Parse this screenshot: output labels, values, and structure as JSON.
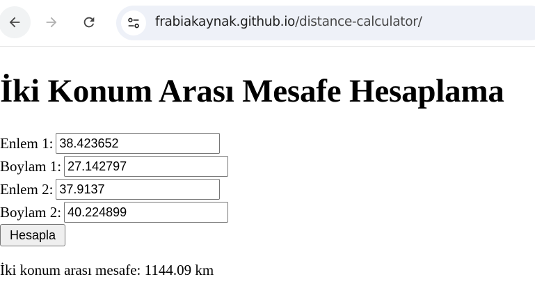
{
  "browser": {
    "url_host": "frabiakaynak.github.io",
    "url_path": "/distance-calculator/"
  },
  "page": {
    "title": "İki Konum Arası Mesafe Hesaplama",
    "fields": [
      {
        "label": "Enlem 1:",
        "value": "38.423652"
      },
      {
        "label": "Boylam 1:",
        "value": "27.142797"
      },
      {
        "label": "Enlem 2:",
        "value": "37.9137"
      },
      {
        "label": "Boylam 2:",
        "value": "40.224899"
      }
    ],
    "button_label": "Hesapla",
    "result_text": "İki konum arası mesafe: 1144.09 km"
  }
}
